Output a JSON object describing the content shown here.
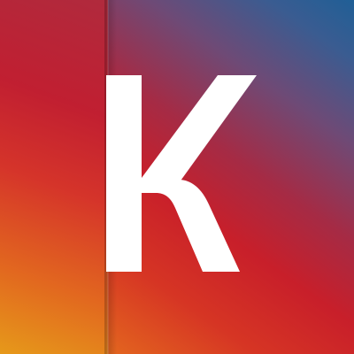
{
  "logo": {
    "letter": "K",
    "letter_color": "#ffffff"
  },
  "colors": {
    "top_right": "#205f96",
    "center": "#c81f2a",
    "bottom_left": "#e8921c"
  }
}
